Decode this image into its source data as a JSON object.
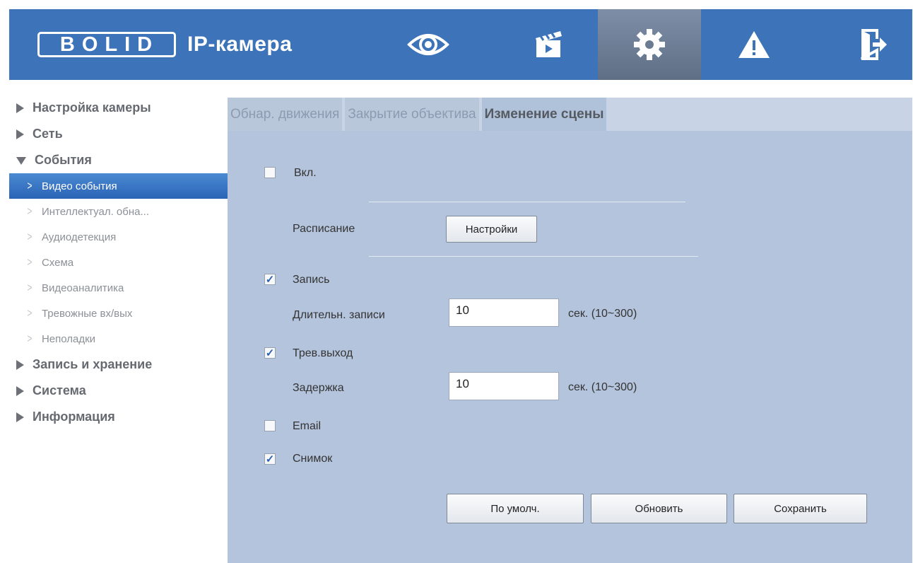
{
  "header": {
    "logo_text": "BOLID",
    "app_title": "IP-камера",
    "nav": [
      {
        "icon": "eye-icon",
        "label": "live-view"
      },
      {
        "icon": "clapperboard-icon",
        "label": "playback"
      },
      {
        "icon": "gear-icon",
        "label": "settings"
      },
      {
        "icon": "warning-icon",
        "label": "alarm"
      },
      {
        "icon": "logout-icon",
        "label": "logout"
      }
    ],
    "active_nav": "settings",
    "colors": {
      "bar": "#3d74b9",
      "active": "#6a7b92"
    }
  },
  "sidebar": {
    "sections": [
      {
        "label": "Настройка камеры",
        "expanded": false
      },
      {
        "label": "Сеть",
        "expanded": false
      },
      {
        "label": "События",
        "expanded": true,
        "items": [
          "Видео события",
          "Интеллектуал. обна...",
          "Аудиодетекция",
          "Схема",
          "Видеоаналитика",
          "Тревожные вх/вых",
          "Неполадки"
        ],
        "active_item": "Видео события"
      },
      {
        "label": "Запись и хранение",
        "expanded": false
      },
      {
        "label": "Система",
        "expanded": false
      },
      {
        "label": "Информация",
        "expanded": false
      }
    ]
  },
  "tabs": [
    {
      "label": "Обнар. движения",
      "active": false
    },
    {
      "label": "Закрытие объектива",
      "active": false
    },
    {
      "label": "Изменение сцены",
      "active": true
    }
  ],
  "form": {
    "enable": {
      "label": "Вкл.",
      "checked": false
    },
    "schedule": {
      "label": "Расписание",
      "button": "Настройки"
    },
    "record": {
      "label": "Запись",
      "checked": true
    },
    "record_duration": {
      "label": "Длительн. записи",
      "value": "10",
      "unit": "сек. (10~300)"
    },
    "alarm_out": {
      "label": "Трев.выход",
      "checked": true
    },
    "delay": {
      "label": "Задержка",
      "value": "10",
      "unit": "сек. (10~300)"
    },
    "email": {
      "label": "Email",
      "checked": false
    },
    "snapshot": {
      "label": "Снимок",
      "checked": true
    }
  },
  "buttons": {
    "default": "По умолч.",
    "refresh": "Обновить",
    "save": "Сохранить"
  }
}
